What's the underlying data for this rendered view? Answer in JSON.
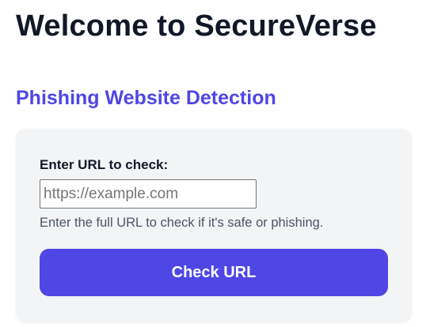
{
  "header": {
    "title": "Welcome to SecureVerse"
  },
  "section": {
    "heading": "Phishing Website Detection"
  },
  "form": {
    "url_label": "Enter URL to check:",
    "url_value": "",
    "url_placeholder": "https://example.com",
    "help_text": "Enter the full URL to check if it's safe or phishing.",
    "submit_label": "Check URL"
  },
  "colors": {
    "accent": "#4f46e5",
    "card_background": "#f3f4f6",
    "title_text": "#111827",
    "muted_text": "#4b5563"
  }
}
